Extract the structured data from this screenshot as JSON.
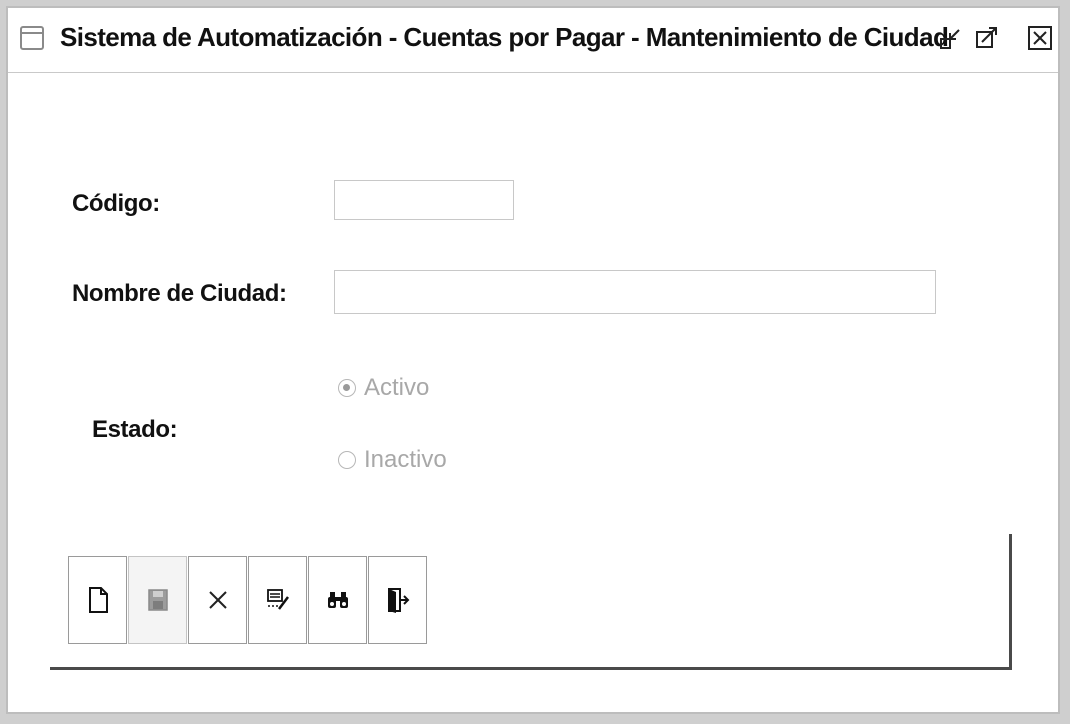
{
  "window": {
    "title": "Sistema de Automatización - Cuentas por Pagar - Mantenimiento de Ciudad"
  },
  "form": {
    "codigo_label": "Código:",
    "codigo_value": "",
    "nombre_label": "Nombre de Ciudad:",
    "nombre_value": "",
    "estado_label": "Estado:",
    "estado_options": [
      {
        "label": "Activo",
        "selected": true
      },
      {
        "label": "Inactivo",
        "selected": false
      }
    ]
  },
  "toolbar": {
    "buttons": [
      {
        "icon": "new-document-icon",
        "enabled": true
      },
      {
        "icon": "save-icon",
        "enabled": false
      },
      {
        "icon": "delete-icon",
        "enabled": true
      },
      {
        "icon": "edit-icon",
        "enabled": true
      },
      {
        "icon": "search-binoculars-icon",
        "enabled": true
      },
      {
        "icon": "exit-door-icon",
        "enabled": true
      }
    ]
  }
}
